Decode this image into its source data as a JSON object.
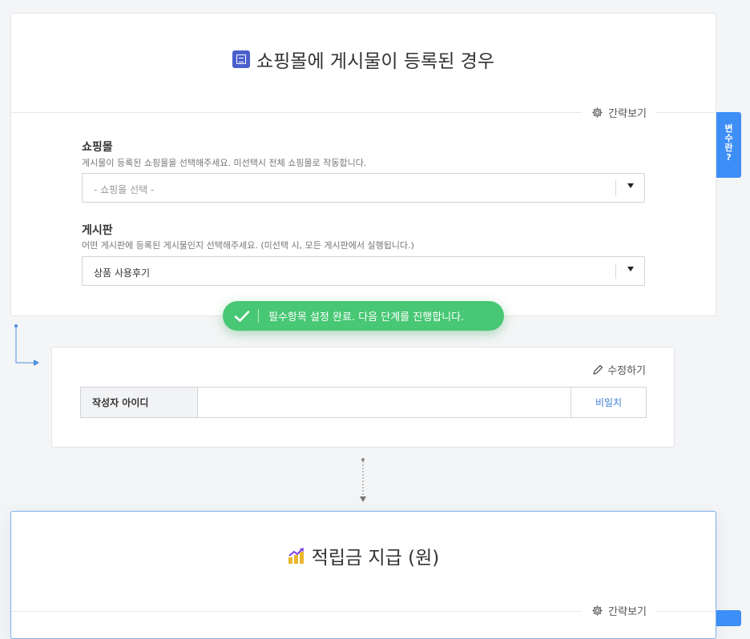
{
  "trigger_card": {
    "title": "쇼핑몰에 게시물이 등록된 경우",
    "simple_view_label": "간략보기",
    "fields": [
      {
        "label": "쇼핑몰",
        "help": "게시물이 등록된 쇼핑몰을 선택해주세요. 미선택시 전체 쇼핑몰로 작동합니다.",
        "placeholder": "- 쇼핑몰 선택 -",
        "value": ""
      },
      {
        "label": "게시판",
        "help": "어떤 게시판에 등록된 게시물인지 선택해주세요. (미선택 시, 모든 게시판에서 실행됩니다.)",
        "placeholder": "",
        "value": "상품 사용후기"
      }
    ]
  },
  "toast": {
    "text": "필수항목 설정 완료. 다음 단계를 진행합니다.",
    "color": "#48c774"
  },
  "variable_card": {
    "edit_label": "수정하기",
    "rows": [
      {
        "key": "작성자 아이디",
        "value": "",
        "action": "비일치"
      }
    ]
  },
  "action_card": {
    "title": "적립금 지급 (원)",
    "simple_view_label": "간략보기"
  },
  "side_tab": {
    "label_lines": [
      "변",
      "수",
      "란",
      "?"
    ]
  },
  "colors": {
    "accent": "#3e8ef7",
    "success": "#48c774",
    "title_icon": "#4a5fcc"
  }
}
